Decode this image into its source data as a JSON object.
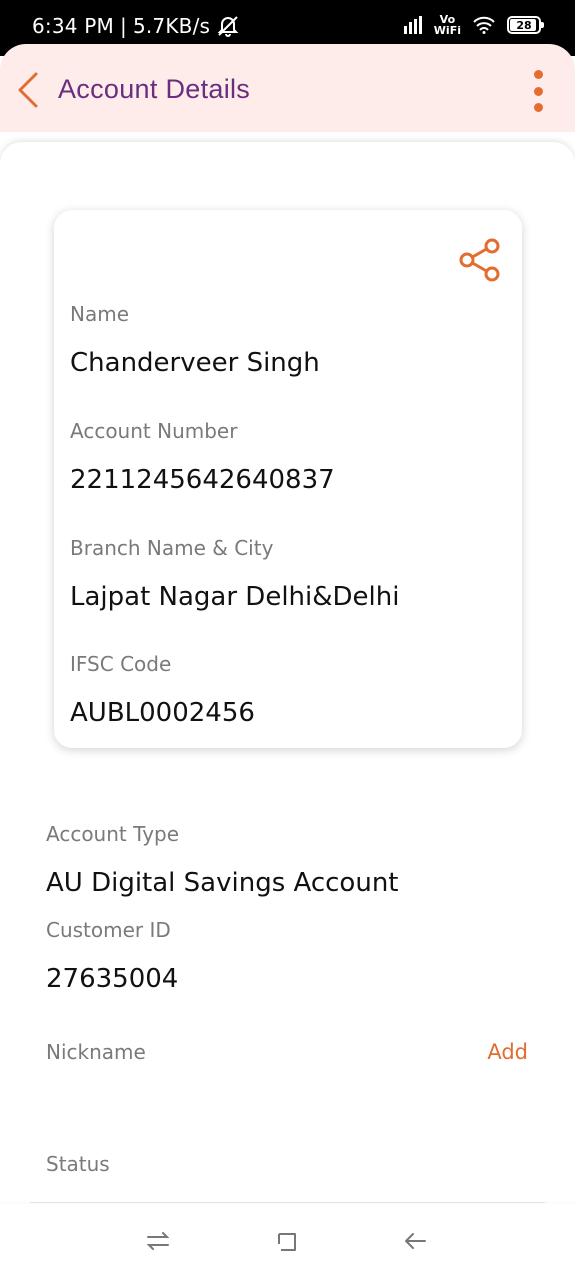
{
  "status_bar": {
    "time": "6:34 PM",
    "separator": "|",
    "speed": "5.7KB/s",
    "network_label": "Vo\nWiFi",
    "battery": "28"
  },
  "header": {
    "title": "Account Details"
  },
  "card": {
    "fields": [
      {
        "label": "Name",
        "value": "Chanderveer Singh"
      },
      {
        "label": "Account Number",
        "value": "2211245642640837"
      },
      {
        "label": "Branch Name & City",
        "value": "Lajpat Nagar Delhi&Delhi"
      },
      {
        "label": "IFSC Code",
        "value": "AUBL0002456"
      }
    ]
  },
  "details": {
    "account_type_label": "Account Type",
    "account_type_value": "AU Digital Savings Account",
    "customer_id_label": "Customer ID",
    "customer_id_value": "27635004",
    "nickname_label": "Nickname",
    "nickname_action": "Add",
    "status_label": "Status"
  },
  "colors": {
    "accent": "#e36d30",
    "title": "#6a2e7e",
    "header_bg": "#fdecea"
  },
  "icons": {
    "back": "chevron-left-icon",
    "more": "more-vertical-icon",
    "share": "share-icon",
    "recents": "recents-icon",
    "home": "home-icon",
    "back_nav": "back-arrow-icon"
  }
}
